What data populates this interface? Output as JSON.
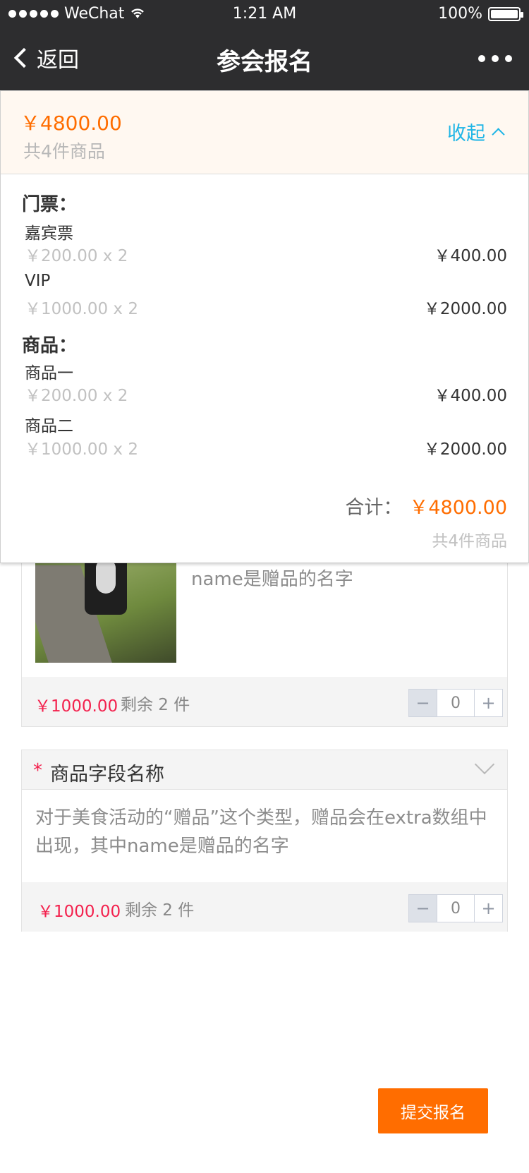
{
  "status_bar": {
    "carrier": "WeChat",
    "time": "1:21 AM",
    "battery": "100%",
    "battery_level": 1.0
  },
  "navbar": {
    "back_label": "返回",
    "title": "参会报名"
  },
  "summary": {
    "total_price": "￥4800.00",
    "total_count": "共4件商品",
    "collapse_label": "收起",
    "sections": [
      {
        "title": "门票：",
        "items": [
          {
            "name": "嘉宾票",
            "unit": "￥200.00 x 2",
            "subtotal": "￥400.00"
          },
          {
            "name": "VIP",
            "unit": "￥1000.00 x 2",
            "subtotal": "￥2000.00"
          }
        ]
      },
      {
        "title": "商品：",
        "items": [
          {
            "name": "商品一",
            "unit": "￥200.00 x 2",
            "subtotal": "￥400.00"
          },
          {
            "name": "商品二",
            "unit": "￥1000.00 x 2",
            "subtotal": "￥2000.00"
          }
        ]
      }
    ],
    "sum_label": "合计：",
    "sum_value": "￥4800.00",
    "sum_count": "共4件商品"
  },
  "card1": {
    "description": "赠品会在extra数组中出现，其中name是赠品的名字",
    "price": "￥1000.00",
    "remaining": "剩余 2 件",
    "quantity": "0"
  },
  "card2": {
    "required_mark": "*",
    "field_title": "商品字段名称",
    "description": "对于美食活动的“赠品”这个类型，赠品会在extra数组中出现，其中name是赠品的名字",
    "price": "￥1000.00",
    "remaining": "剩余 2 件",
    "quantity": "0"
  },
  "submit_label": "提交报名",
  "stepper": {
    "minus": "−",
    "plus": "+"
  }
}
